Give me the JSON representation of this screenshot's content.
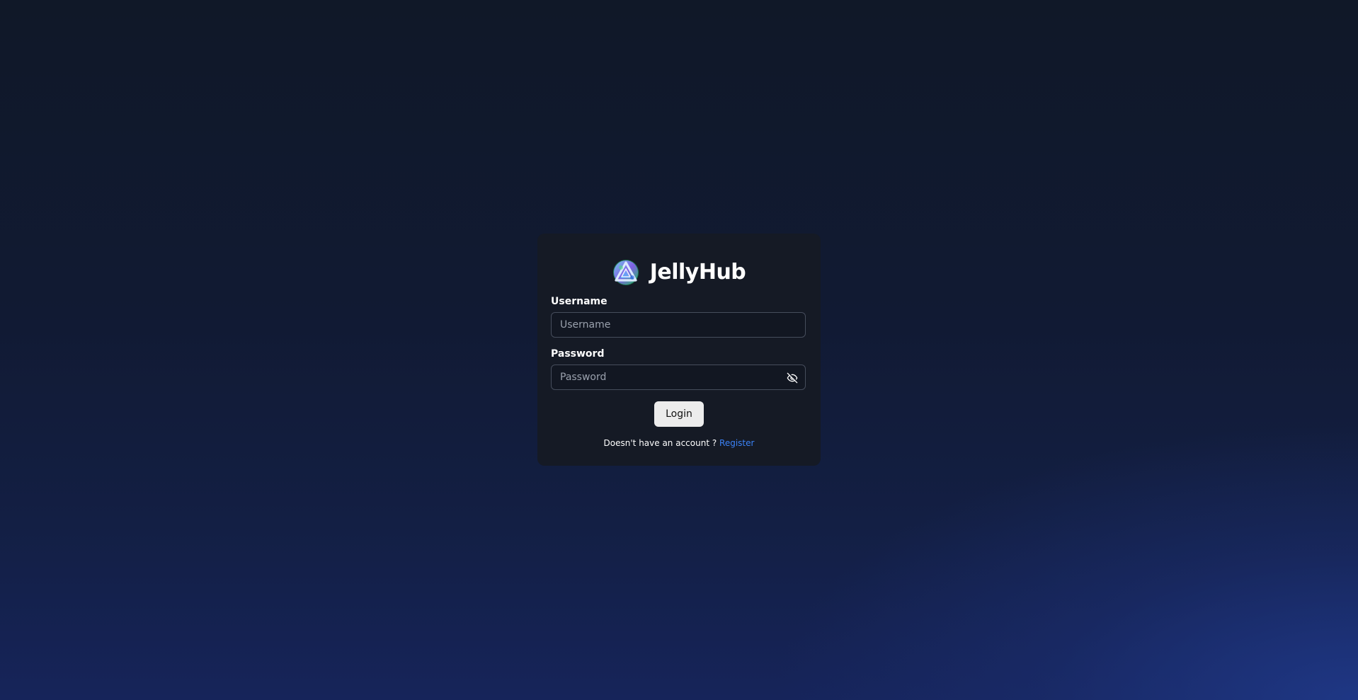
{
  "brand": {
    "name": "JellyHub",
    "logo_icon": "jellyhub-logo"
  },
  "form": {
    "username": {
      "label": "Username",
      "placeholder": "Username",
      "value": ""
    },
    "password": {
      "label": "Password",
      "placeholder": "Password",
      "value": "",
      "toggle_icon": "eye-off-icon"
    },
    "login_label": "Login",
    "register_prompt": "Doesn't have an account ?",
    "register_link": "Register"
  },
  "colors": {
    "card_background": "#151a25",
    "input_border": "#464d5c",
    "button_background": "#ececec",
    "link": "#3b82f6",
    "page_gradient_dark": "#101828",
    "page_gradient_light": "#1e3a8a"
  }
}
